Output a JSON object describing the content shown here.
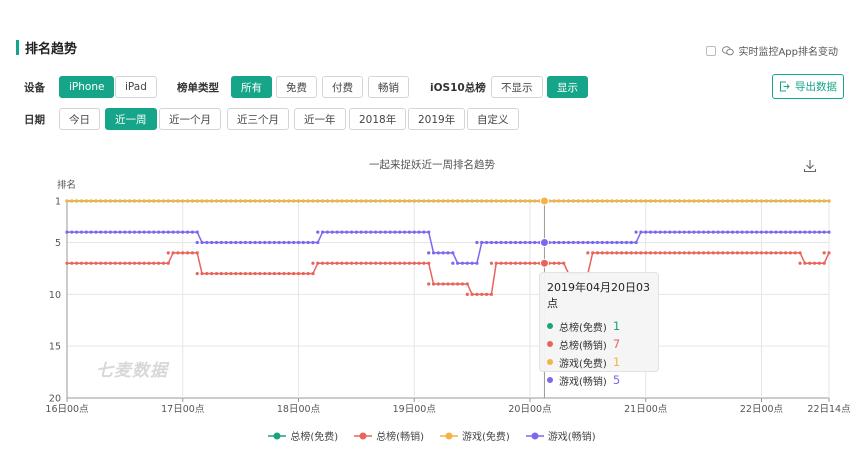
{
  "header": {
    "title": "排名趋势",
    "realtime_label": "实时监控App排名变动"
  },
  "filters": {
    "device_label": "设备",
    "devices": [
      "iPhone",
      "iPad"
    ],
    "device_selected": 0,
    "list_type_label": "榜单类型",
    "list_types": [
      "所有",
      "免费",
      "付费",
      "畅销"
    ],
    "list_type_selected": 0,
    "ios10_label": "iOS10总榜",
    "ios10_options": [
      "不显示",
      "显示"
    ],
    "ios10_selected": 1,
    "date_label": "日期",
    "dates": [
      "今日",
      "近一周",
      "近一个月",
      "近三个月",
      "近一年",
      "2018年",
      "2019年",
      "自定义"
    ],
    "date_selected": 1,
    "export_label": "导出数据"
  },
  "chart_data": {
    "type": "line",
    "title": "一起来捉妖近一周排名趋势",
    "ylabel": "排名",
    "y_inverted": true,
    "ylim": [
      1,
      20
    ],
    "yticks": [
      1,
      5,
      10,
      15,
      20
    ],
    "xticks": [
      "16日00点",
      "17日00点",
      "18日00点",
      "19日00点",
      "20日00点",
      "21日00点",
      "22日00点",
      "22日14点"
    ],
    "x_range_hours": [
      0,
      158
    ],
    "grid": true,
    "legend_position": "bottom",
    "series": [
      {
        "name": "总榜(免费)",
        "color": "#1aa37e",
        "segments": [
          [
            0,
            158,
            1
          ]
        ]
      },
      {
        "name": "总榜(畅销)",
        "color": "#e8645a",
        "segments": [
          [
            0,
            21,
            7
          ],
          [
            21,
            27,
            6
          ],
          [
            27,
            51,
            8
          ],
          [
            51,
            75,
            7
          ],
          [
            75,
            83,
            9
          ],
          [
            83,
            88,
            10
          ],
          [
            88,
            103,
            7
          ],
          [
            103,
            108,
            8
          ],
          [
            108,
            152,
            6
          ],
          [
            152,
            157,
            7
          ],
          [
            157,
            158,
            6
          ]
        ]
      },
      {
        "name": "游戏(免费)",
        "color": "#f5b246",
        "segments": [
          [
            0,
            158,
            1
          ]
        ]
      },
      {
        "name": "游戏(畅销)",
        "color": "#7b68ee",
        "segments": [
          [
            0,
            27,
            4
          ],
          [
            27,
            52,
            5
          ],
          [
            52,
            75,
            4
          ],
          [
            75,
            80,
            6
          ],
          [
            80,
            85,
            7
          ],
          [
            85,
            86,
            5
          ],
          [
            86,
            118,
            5
          ],
          [
            118,
            158,
            4
          ]
        ]
      }
    ]
  },
  "tooltip": {
    "title": "2019年04月20日03点",
    "items": [
      {
        "name": "总榜(免费)",
        "value": "1",
        "color": "#1aa37e"
      },
      {
        "name": "总榜(畅销)",
        "value": "7",
        "color": "#e8645a"
      },
      {
        "name": "游戏(免费)",
        "value": "1",
        "color": "#f5b246"
      },
      {
        "name": "游戏(畅销)",
        "value": "5",
        "color": "#7b68ee"
      }
    ]
  },
  "watermark": "七麦数据"
}
